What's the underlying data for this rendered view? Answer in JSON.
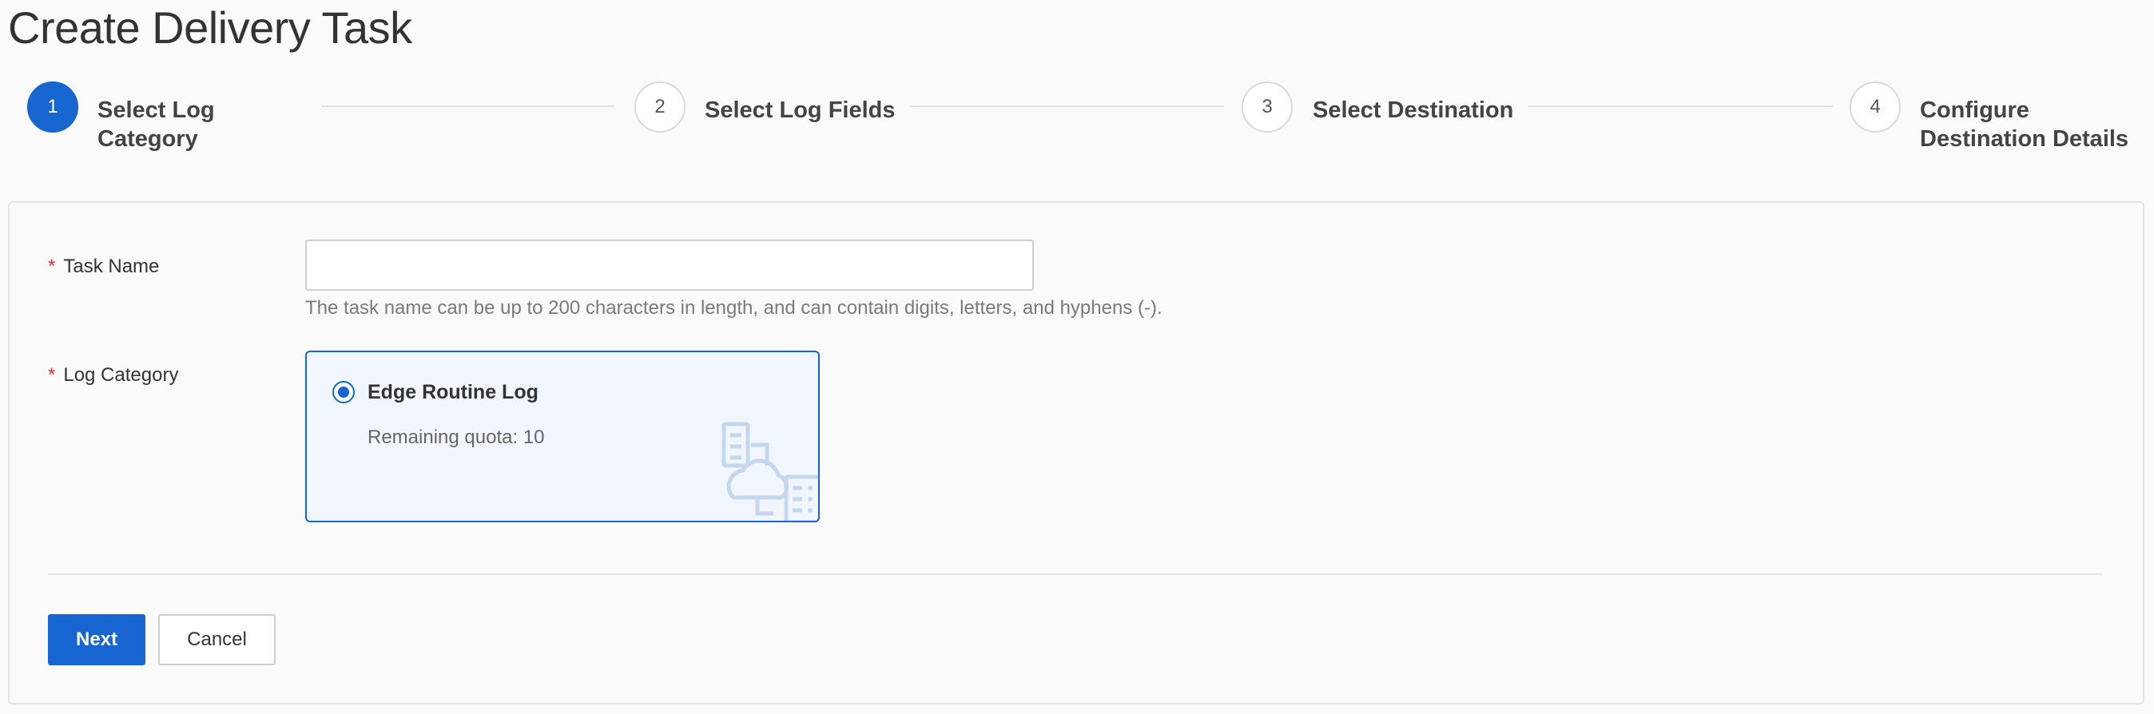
{
  "page": {
    "title": "Create Delivery Task"
  },
  "steps": [
    {
      "number": "1",
      "label_line1": "Select Log",
      "label_line2": "Category",
      "active": true
    },
    {
      "number": "2",
      "label_line1": "Select Log Fields",
      "label_line2": "",
      "active": false
    },
    {
      "number": "3",
      "label_line1": "Select Destination",
      "label_line2": "",
      "active": false
    },
    {
      "number": "4",
      "label_line1": "Configure",
      "label_line2": "Destination Details",
      "active": false
    }
  ],
  "form": {
    "required_mark": "*",
    "task_name": {
      "label": "Task Name",
      "value": "",
      "placeholder": "",
      "help": "The task name can be up to 200 characters in length, and can contain digits, letters, and hyphens (-)."
    },
    "log_category": {
      "label": "Log Category",
      "option": {
        "title": "Edge Routine Log",
        "quota": "Remaining quota: 10",
        "selected": true,
        "icon": "server-cloud-illustration-icon"
      }
    }
  },
  "actions": {
    "next": "Next",
    "cancel": "Cancel"
  },
  "colors": {
    "primary": "#1665d0",
    "required": "#e0303a",
    "selected_bg": "#f1f6fd"
  }
}
